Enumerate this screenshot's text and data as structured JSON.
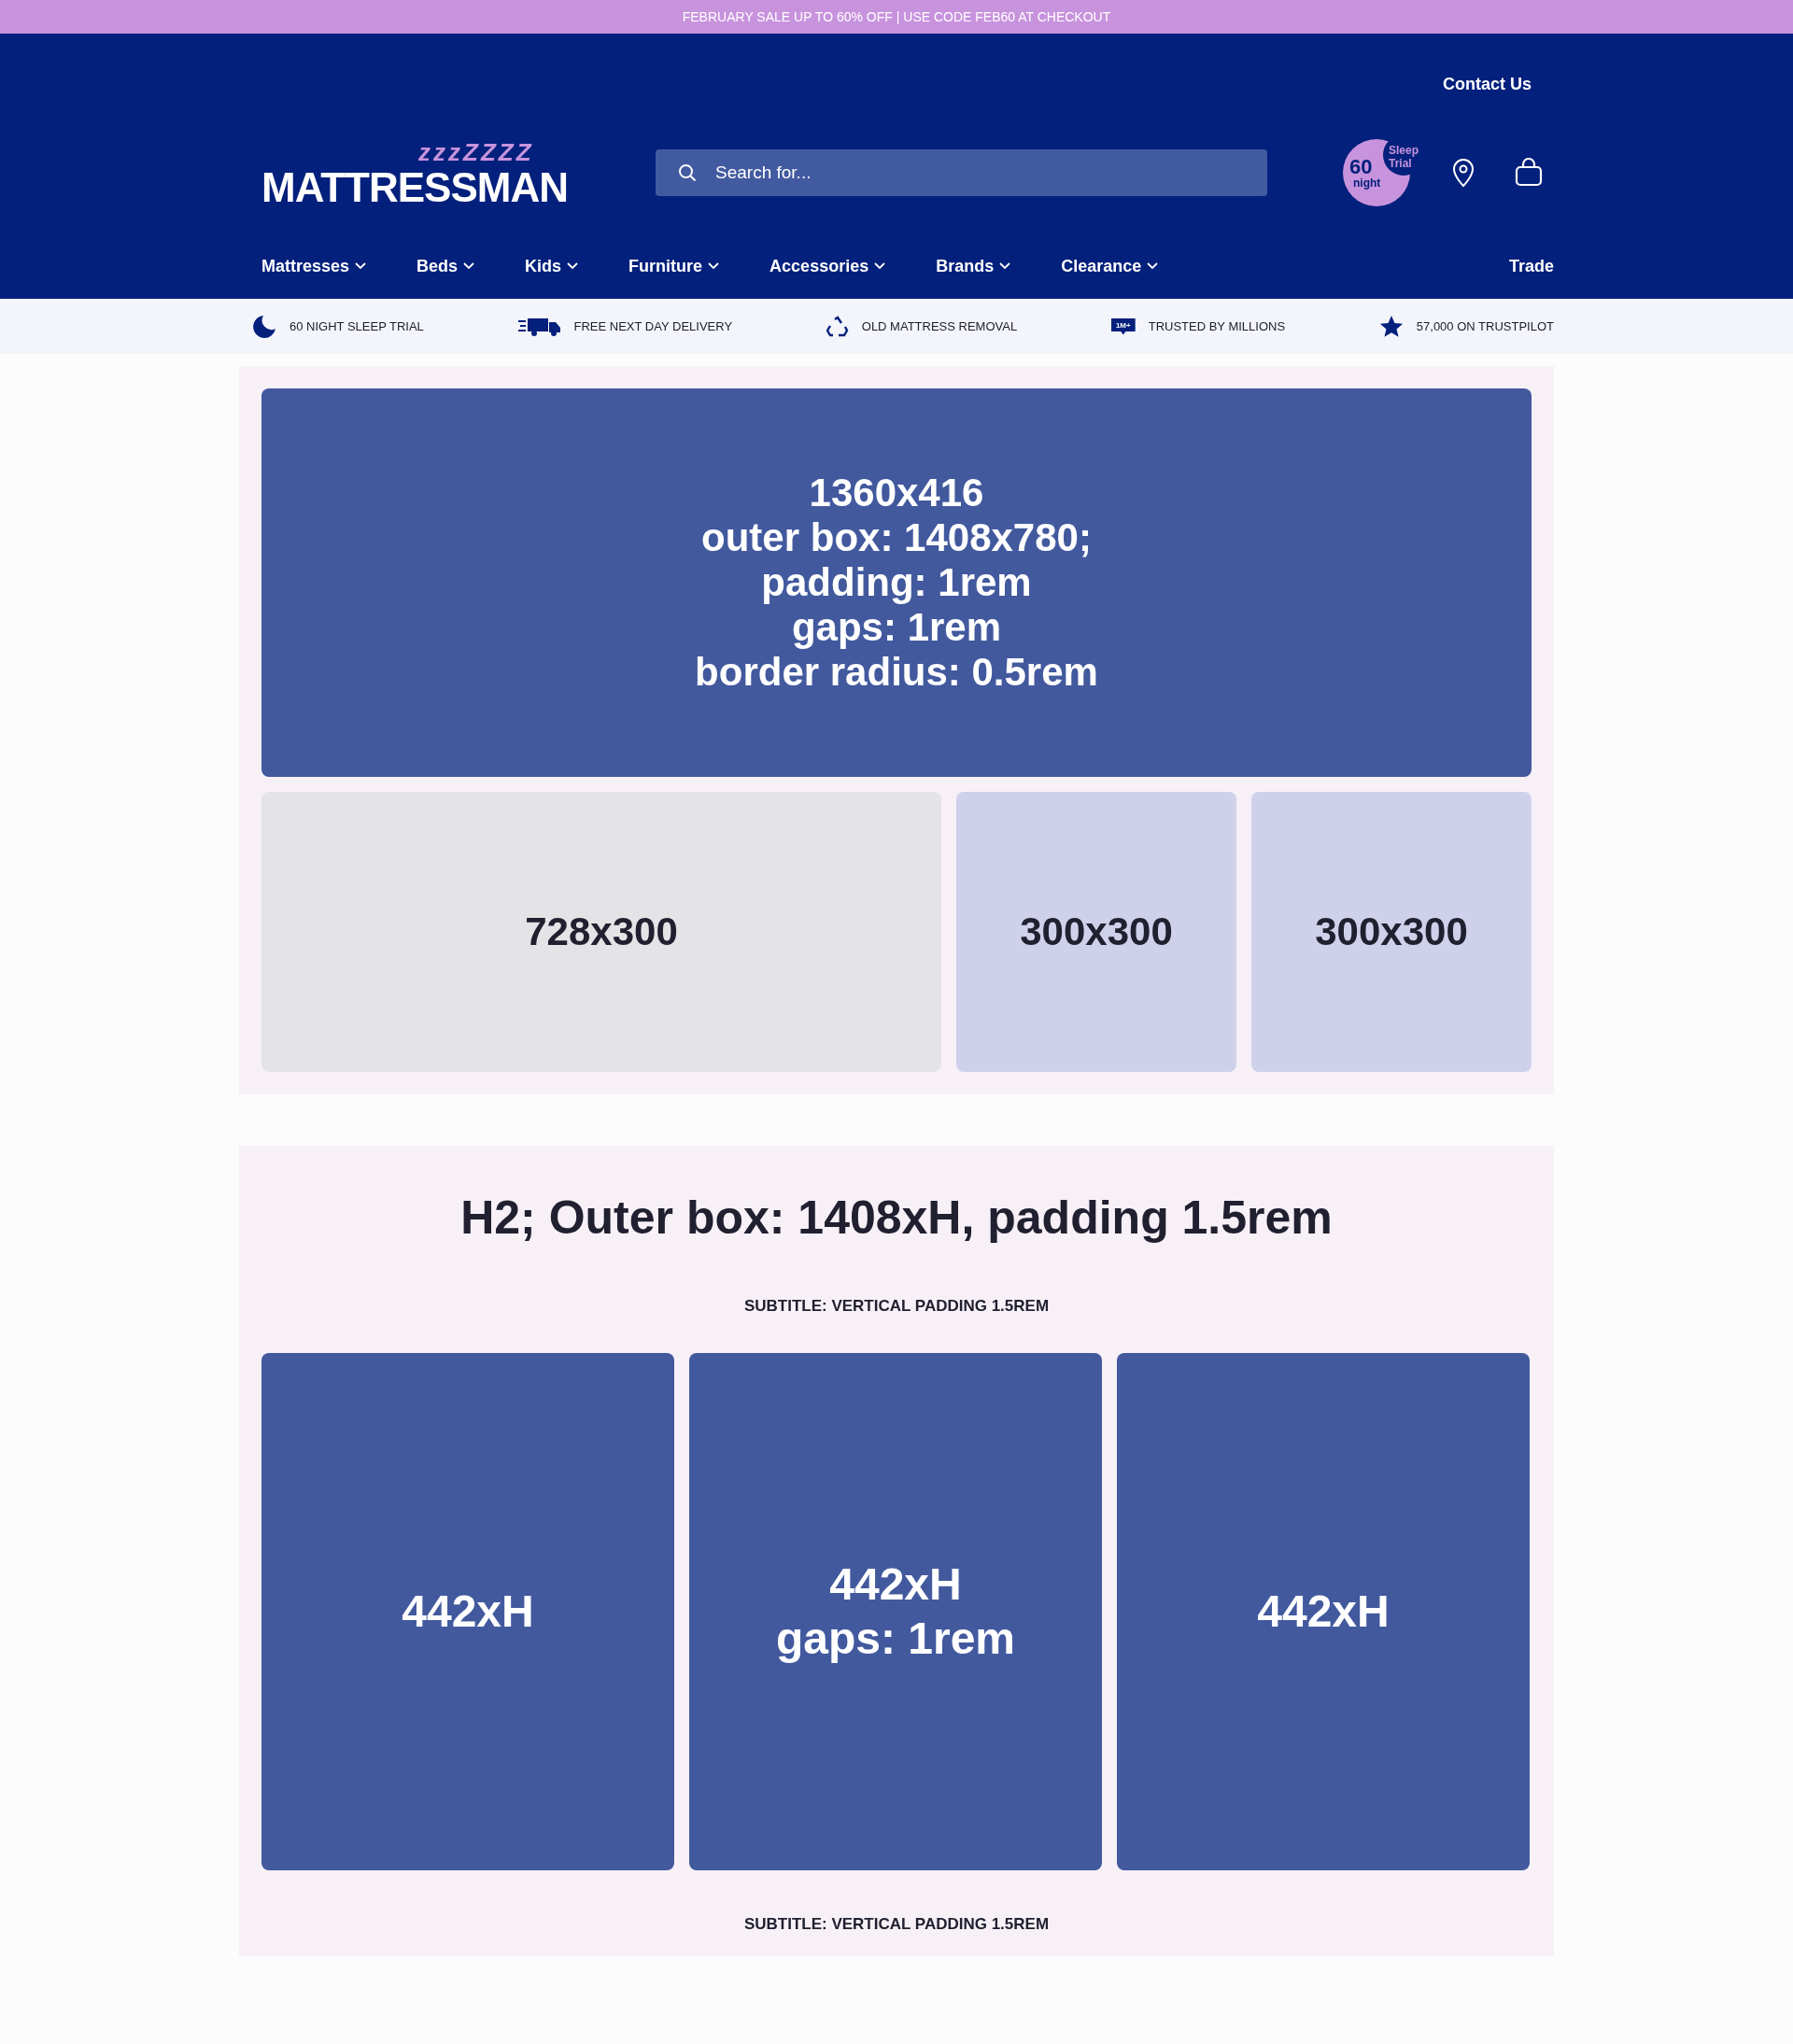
{
  "promo_bar": {
    "text": "FEBRUARY SALE UP TO 60% OFF | USE CODE FEB60 AT CHECKOUT"
  },
  "header": {
    "contact_link": "Contact Us",
    "logo": {
      "text": "MATTRESSMAN",
      "zzz": "zzzZZZZ"
    },
    "search": {
      "placeholder": "Search for..."
    },
    "trial_badge": {
      "number": "60",
      "unit": "night",
      "label_1": "Sleep",
      "label_2": "Trial"
    }
  },
  "nav": {
    "items": [
      {
        "label": "Mattresses",
        "dropdown": true
      },
      {
        "label": "Beds",
        "dropdown": true
      },
      {
        "label": "Kids",
        "dropdown": true
      },
      {
        "label": "Furniture",
        "dropdown": true
      },
      {
        "label": "Accessories",
        "dropdown": true
      },
      {
        "label": "Brands",
        "dropdown": true
      },
      {
        "label": "Clearance",
        "dropdown": true
      }
    ],
    "trade": "Trade"
  },
  "usp_bar": [
    {
      "kind": "moon",
      "text": "60 NIGHT SLEEP TRIAL"
    },
    {
      "kind": "truck",
      "text": "FREE NEXT DAY DELIVERY"
    },
    {
      "kind": "recycle",
      "text": "OLD MATTRESS REMOVAL"
    },
    {
      "kind": "speech",
      "badge": "1M+",
      "text": "TRUSTED BY MILLIONS"
    },
    {
      "kind": "star",
      "text": "57,000 ON TRUSTPILOT"
    }
  ],
  "hero_section": {
    "hero": {
      "lines": [
        "1360x416",
        "outer box: 1408x780;",
        "padding: 1rem",
        "gaps: 1rem",
        "border radius: 0.5rem"
      ]
    },
    "tiles": [
      {
        "kind": "wide",
        "label": "728x300"
      },
      {
        "kind": "square",
        "label": "300x300"
      },
      {
        "kind": "square",
        "label": "300x300"
      }
    ]
  },
  "content_section": {
    "heading": "H2; Outer box: 1408xH, padding 1.5rem",
    "subtitle_top": "SUBTITLE: VERTICAL PADDING 1.5REM",
    "cards": [
      {
        "lines": [
          "442xH"
        ]
      },
      {
        "lines": [
          "442xH",
          "gaps: 1rem"
        ]
      },
      {
        "lines": [
          "442xH"
        ]
      }
    ],
    "subtitle_bottom": "SUBTITLE: VERTICAL PADDING 1.5REM"
  }
}
